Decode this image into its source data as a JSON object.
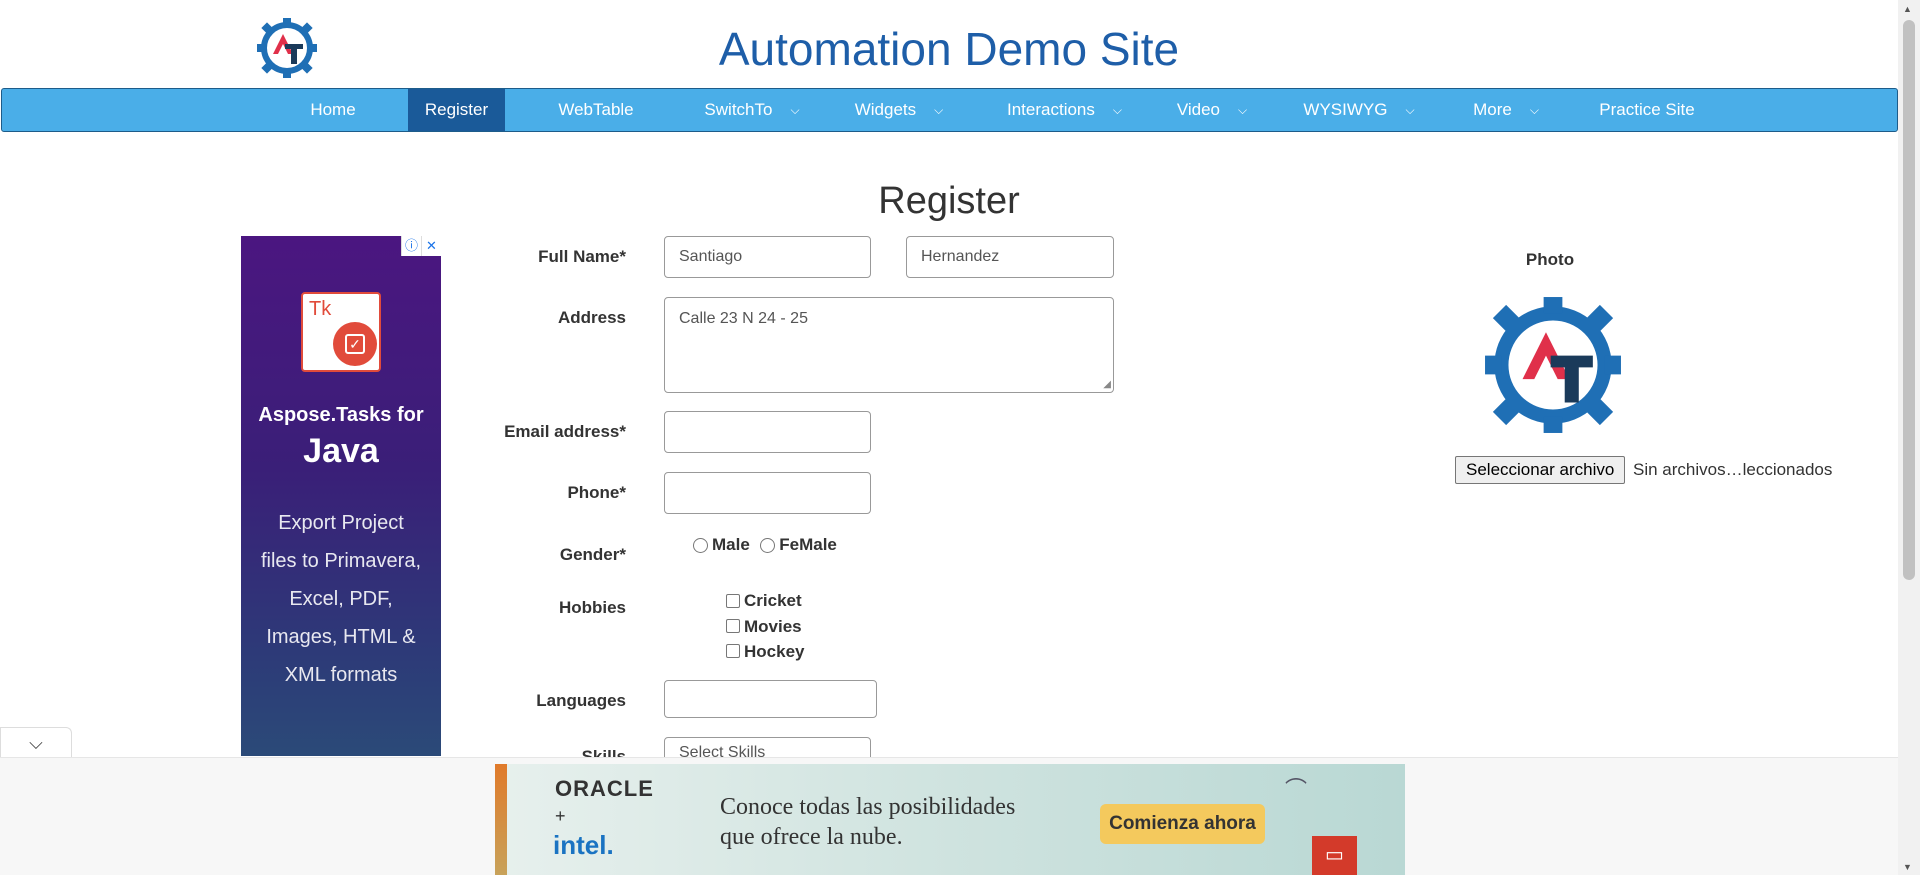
{
  "header": {
    "site_title": "Automation Demo Site",
    "logo_icon": "automation-gear-logo"
  },
  "nav": {
    "items": [
      {
        "label": "Home",
        "dropdown": false,
        "active": false
      },
      {
        "label": "Register",
        "dropdown": false,
        "active": true
      },
      {
        "label": "WebTable",
        "dropdown": false,
        "active": false
      },
      {
        "label": "SwitchTo",
        "dropdown": true,
        "active": false
      },
      {
        "label": "Widgets",
        "dropdown": true,
        "active": false
      },
      {
        "label": "Interactions",
        "dropdown": true,
        "active": false
      },
      {
        "label": "Video",
        "dropdown": true,
        "active": false
      },
      {
        "label": "WYSIWYG",
        "dropdown": true,
        "active": false
      },
      {
        "label": "More",
        "dropdown": true,
        "active": false
      },
      {
        "label": "Practice Site",
        "dropdown": false,
        "active": false
      }
    ],
    "chevron": "⌵"
  },
  "page": {
    "heading": "Register"
  },
  "form": {
    "full_name_label": "Full Name*",
    "first_name_value": "Santiago",
    "last_name_value": "Hernandez",
    "address_label": "Address",
    "address_value": "Calle 23 N 24 - 25",
    "email_label": "Email address*",
    "email_value": "",
    "phone_label": "Phone*",
    "phone_value": "",
    "gender_label": "Gender*",
    "gender_options": [
      "Male",
      "FeMale"
    ],
    "hobbies_label": "Hobbies",
    "hobbies_options": [
      "Cricket",
      "Movies",
      "Hockey"
    ],
    "languages_label": "Languages",
    "skills_label": "Skills",
    "skills_placeholder": "Select Skills"
  },
  "photo": {
    "label": "Photo",
    "file_button": "Seleccionar archivo",
    "file_status": "Sin archivos…leccionados"
  },
  "ad_left": {
    "icon_text": "Tk",
    "brand": "Aspose.Tasks for",
    "lang": "Java",
    "desc": "Export Project files to Primavera, Excel, PDF, Images, HTML & XML formats",
    "info_icon": "ⓘ",
    "close_icon": "✕"
  },
  "ad_bottom": {
    "brand1": "ORACLE",
    "plus": "+",
    "brand2": "intel.",
    "tagline_line1": "Conoce todas las posibilidades",
    "tagline_line2": "que ofrece la nube.",
    "cta": "Comienza ahora"
  },
  "colors": {
    "nav_bg": "#4aaee8",
    "nav_active": "#1a5a99",
    "title": "#1e5ea8"
  }
}
